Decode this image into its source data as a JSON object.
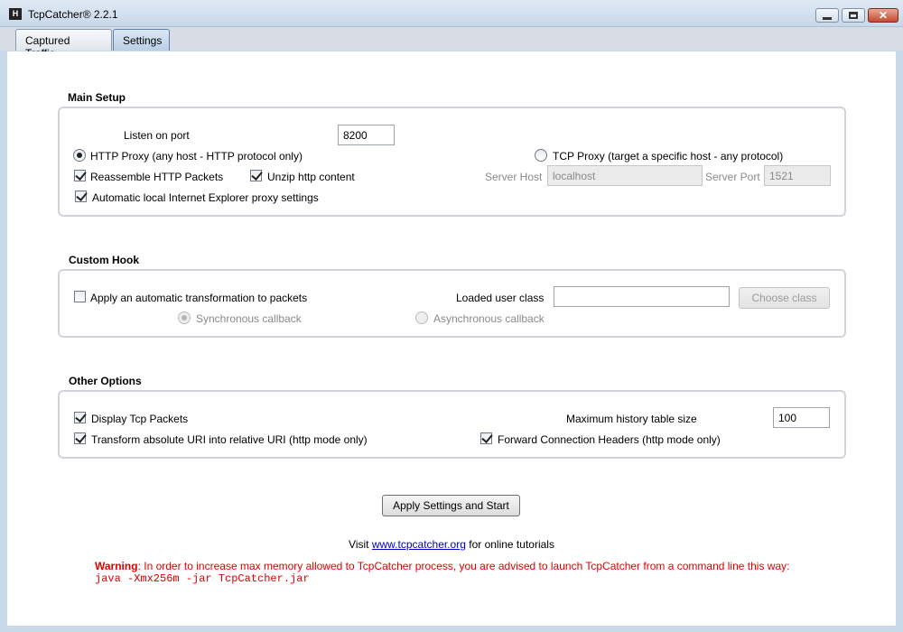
{
  "window": {
    "title": "TcpCatcher® 2.2.1",
    "app_icon_glyph": "H"
  },
  "tabs": [
    {
      "label": "Captured Traffic",
      "active": false
    },
    {
      "label": "Settings",
      "active": true
    }
  ],
  "main_setup": {
    "title": "Main Setup",
    "listen_label": "Listen on port",
    "listen_port": "8200",
    "http_proxy_label": "HTTP Proxy (any host - HTTP protocol only)",
    "http_proxy_selected": true,
    "tcp_proxy_label": "TCP Proxy (target a specific host - any protocol)",
    "tcp_proxy_selected": false,
    "reassemble_label": "Reassemble HTTP Packets",
    "reassemble_checked": true,
    "unzip_label": "Unzip http content",
    "unzip_checked": true,
    "auto_ie_label": "Automatic local Internet Explorer proxy settings",
    "auto_ie_checked": true,
    "server_host_label": "Server Host",
    "server_host_value": "localhost",
    "server_port_label": "Server Port",
    "server_port_value": "1521"
  },
  "custom_hook": {
    "title": "Custom Hook",
    "apply_label": "Apply an automatic transformation to packets",
    "apply_checked": false,
    "loaded_class_label": "Loaded user class",
    "loaded_class_value": "",
    "choose_class_label": "Choose class",
    "sync_label": "Synchronous callback",
    "async_label": "Asynchronous callback"
  },
  "other_options": {
    "title": "Other Options",
    "display_tcp_label": "Display Tcp Packets",
    "display_tcp_checked": true,
    "transform_uri_label": "Transform absolute URI into relative URI (http mode only)",
    "transform_uri_checked": true,
    "max_history_label": "Maximum history table size",
    "max_history_value": "100",
    "forward_headers_label": "Forward Connection Headers (http mode only)",
    "forward_headers_checked": true
  },
  "apply_button_label": "Apply Settings and Start",
  "footer": {
    "visit_prefix": "Visit",
    "visit_link": "www.tcpcatcher.org",
    "visit_suffix": "for online tutorials",
    "warning_label": "Warning",
    "warning_text": ": In order to increase max memory allowed to TcpCatcher process, you are advised to launch TcpCatcher from a command line this way:",
    "warning_command": "java -Xmx256m -jar TcpCatcher.jar"
  },
  "colors": {
    "warning": "#e00000",
    "link": "#0000cc",
    "title_bar": "#d0ddec"
  }
}
